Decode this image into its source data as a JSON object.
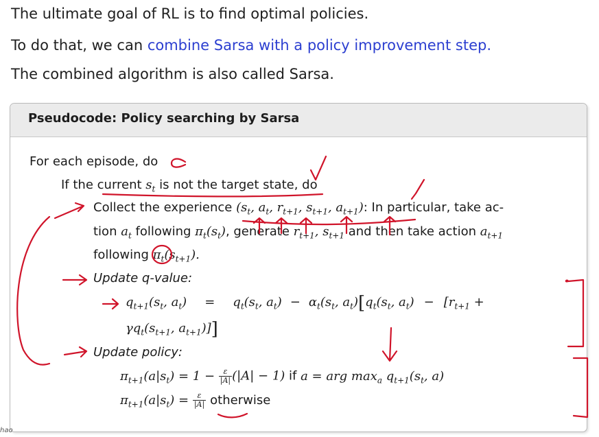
{
  "intro": {
    "line1": "The ultimate goal of RL is to find optimal policies.",
    "line2_prefix": "To do that, we can ",
    "line2_link": "combine Sarsa with a policy improvement step.",
    "line3": "The combined algorithm is also called Sarsa."
  },
  "box": {
    "title": "Pseudocode: Policy searching by Sarsa",
    "for_each": "For each episode, do",
    "if_prefix": "If the ",
    "if_current": "current ",
    "if_middle": " is not the target state, do",
    "collect_prefix": "Collect the experience ",
    "collect_tuple": "(s_t, a_t, r_{t+1}, s_{t+1}, a_{t+1})",
    "collect_suffix": ": In particular, take ac-",
    "action_line_start": "tion ",
    "action_line_following": " following ",
    "action_line_generate": ", generate ",
    "action_line_and": " and then take action ",
    "following": "following ",
    "update_q_label": "Update q-value:",
    "q_lhs": "q_{t+1}(s_t, a_t)",
    "q_eq": "=",
    "q_rhs1": "q_t(s_t, a_t)",
    "q_minus": "−",
    "q_alpha": "α_t(s_t, a_t)",
    "q_bracket_q": "q_t(s_t, a_t)",
    "q_r": "[r_{t+1} +",
    "q_line2": "γq_t(s_{t+1}, a_{t+1})]]",
    "update_policy_label": "Update policy:",
    "pol_line1_lhs": "π_{t+1}(a|s_t) = 1 −",
    "pol_line1_rest": "(|A| − 1) if a = arg max_a q_{t+1}(s_t, a)",
    "pol_line2_lhs": "π_{t+1}(a|s_t) =",
    "pol_line2_otherwise": "otherwise",
    "frac_num": "ε",
    "frac_den": "|A|"
  },
  "footer_corner": "hao",
  "colors": {
    "accent_blue": "#2b3ed0",
    "annotation_red": "#d0142a",
    "header_gray": "#ebebeb"
  }
}
